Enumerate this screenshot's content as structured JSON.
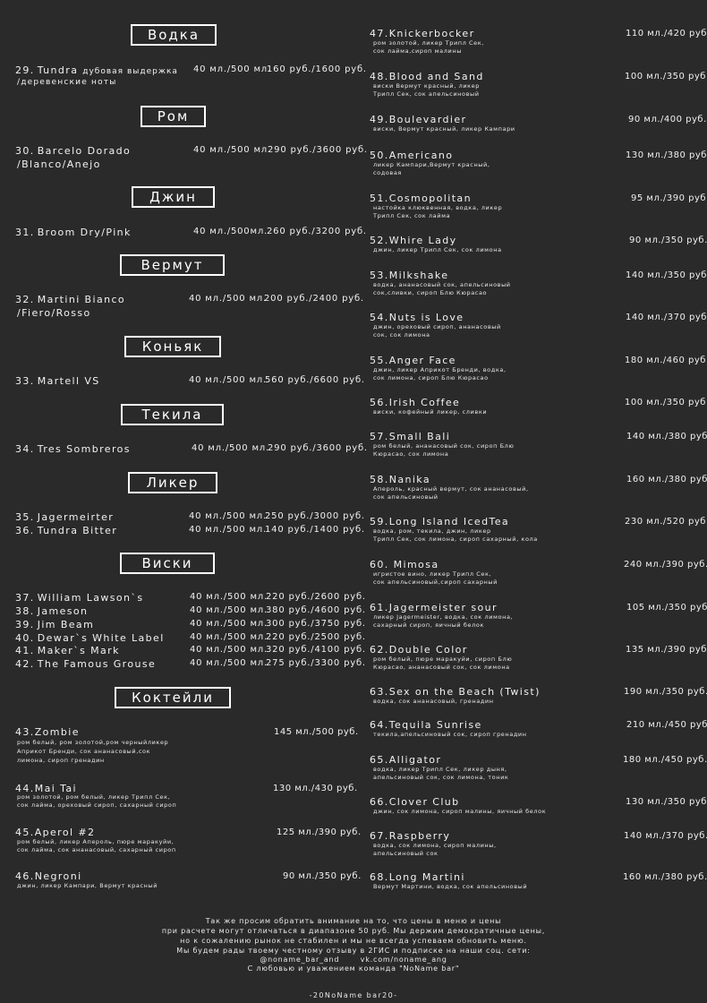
{
  "categories": {
    "vodka": "Водка",
    "rum": "Ром",
    "gin": "Джин",
    "vermouth": "Вермут",
    "cognac": "Коньяк",
    "tequila": "Текила",
    "liqueur": "Ликер",
    "whisky": "Виски",
    "cocktails": "Коктейли"
  },
  "drinks": [
    {
      "num": "29.",
      "name": "Tundra",
      "sub": "дубовая выдержка",
      "line2": "/деревенские ноты",
      "volume": "40 мл./500 мл.",
      "price": "160 руб./1600 руб."
    },
    {
      "num": "30.",
      "name": "Barcelo Dorado",
      "line2": "/Blanco/Anejo",
      "volume": "40 мл./500 мл.",
      "price": "290 руб./3600 руб."
    },
    {
      "num": "31.",
      "name": "Broom Dry/Pink",
      "volume": "40 мл./500мл.",
      "price": "260 руб./3200 руб."
    },
    {
      "num": "32.",
      "name": "Martini Bianco",
      "line2": "/Fiero/Rosso",
      "volume": "40 мл./500 мл.",
      "price": "200 руб./2400 руб."
    },
    {
      "num": "33.",
      "name": "Martell VS",
      "volume": "40 мл./500 мл.",
      "price": "560 руб./6600 руб."
    },
    {
      "num": "34.",
      "name": "Tres Sombreros",
      "volume": "40 мл./500 мл.",
      "price": "290 руб./3600 руб."
    },
    {
      "num": "35.",
      "name": "Jagermeirter",
      "volume": "40 мл./500 мл.",
      "price": "250 руб./3000 руб."
    },
    {
      "num": "36.",
      "name": "Tundra Bitter",
      "volume": "40 мл./500 мл.",
      "price": "140 руб./1400 руб."
    },
    {
      "num": "37.",
      "name": "William Lawson`s",
      "volume": "40 мл./500 мл.",
      "price": "220 руб./2600 руб."
    },
    {
      "num": "38.",
      "name": "Jameson",
      "volume": "40 мл./500 мл.",
      "price": "380 руб./4600 руб."
    },
    {
      "num": "39.",
      "name": "Jim Beam",
      "volume": "40 мл./500 мл.",
      "price": "300 руб./3750 руб."
    },
    {
      "num": "40.",
      "name": "Dewar`s White Label",
      "volume": "40 мл./500 мл.",
      "price": "220 руб./2500 руб."
    },
    {
      "num": "41.",
      "name": "Maker`s Mark",
      "volume": "40 мл./500 мл.",
      "price": "320 руб./4100 руб."
    },
    {
      "num": "42.",
      "name": "The Famous Grouse",
      "volume": "40 мл./500 мл.",
      "price": "275 руб./3300 руб."
    }
  ],
  "cocktails": [
    {
      "num": "43.",
      "name": "Zombie",
      "desc": [
        "ром белый, ром золотой,ром черныйликер",
        "Априкот Бренди, сок ананасовый,сок",
        "лимона, сироп гренадин"
      ],
      "price": "145 мл./500 руб."
    },
    {
      "num": "44.",
      "name": "Mai Tai",
      "desc": [
        "ром золотой, ром белый, ликер Трипл Сек,",
        "сок лайма, ореховый сироп, сахарный сироп"
      ],
      "price": "130 мл./430 руб."
    },
    {
      "num": "45.",
      "name": "Aperol #2",
      "desc": [
        "ром белый, ликер Апероль, пюре маракуйи,",
        "сок лайма, сок ананасовый, сахарный сироп"
      ],
      "price": "125 мл./390 руб."
    },
    {
      "num": "46.",
      "name": "Negroni",
      "desc": [
        "джин, ликер Кампари, Вермут красный"
      ],
      "price": "90 мл./350 руб."
    },
    {
      "num": "47.",
      "name": "Knickerbocker",
      "desc": [
        "ром золотой, ликер Трипл Сек,",
        "сок лайма,сироп малины"
      ],
      "price": "110 мл./420 руб."
    },
    {
      "num": "48.",
      "name": "Blood and Sand",
      "desc": [
        "виски Вермут красный, ликер",
        "Трипл Сек, сок апельсиновый"
      ],
      "price": "100 мл./350 руб."
    },
    {
      "num": "49.",
      "name": "Boulevardier",
      "desc": [
        "виски, Вермут красный, ликер Кампари"
      ],
      "price": "90 мл./400 руб."
    },
    {
      "num": "50.",
      "name": "Americano",
      "desc": [
        "ликер Кампари,Вермут красный,",
        "содовая"
      ],
      "price": "130 мл./380 руб."
    },
    {
      "num": "51.",
      "name": "Cosmopolitan",
      "desc": [
        "настойка клюквенная, водка, ликер",
        "Трипл Сек, сок лайма"
      ],
      "price": "95 мл./390 руб."
    },
    {
      "num": "52.",
      "name": "Whire Lady",
      "desc": [
        "джин, ликер Трипл Сек, сок лимона"
      ],
      "price": "90 мл./350 руб."
    },
    {
      "num": "53.",
      "name": "Milkshake",
      "desc": [
        "водка, ананасовый сок, апельсиновый",
        "сок,сливки, сироп Блю Кюрасао"
      ],
      "price": "140 мл./350 руб."
    },
    {
      "num": "54.",
      "name": "Nuts is Love",
      "desc": [
        "джин, ореховый сироп, ананасовый",
        "сок, сок лимона"
      ],
      "price": "140 мл./370 руб."
    },
    {
      "num": "55.",
      "name": "Anger Face",
      "desc": [
        "джин, ликер Априкот Бренди, водка,",
        "сок лимона, сироп Блю Кюрасао"
      ],
      "price": "180 мл./460 руб."
    },
    {
      "num": "56.",
      "name": "Irish Coffee",
      "desc": [
        "виски, кофейный ликер, сливки"
      ],
      "price": "100 мл./350 руб."
    },
    {
      "num": "57.",
      "name": "Small Bali",
      "desc": [
        "ром белый, ананасовый сок, сироп Блю",
        "Кюрасао, сок лимона"
      ],
      "price": "140 мл./380 руб."
    },
    {
      "num": "58.",
      "name": "Nanika",
      "desc": [
        "Апероль, красный вермут, сок ананасовый,",
        "сок апельсиновый"
      ],
      "price": "160 мл./380 руб."
    },
    {
      "num": "59.",
      "name": "Long Island IcedTea",
      "desc": [
        "водка, ром, текила, джин, ликер",
        "Трипл Сек, сок лимона, сироп сахарный, кола"
      ],
      "price": "230 мл./520 руб."
    },
    {
      "num": "60.",
      "name": " Mimosa",
      "desc": [
        "игристое вино, ликер Трипл Сек,",
        "сок апельсиновый,сироп сахарный"
      ],
      "price": "240 мл./390 руб."
    },
    {
      "num": "61.",
      "name": "Jagermeister sour",
      "desc": [
        "ликер Jagermeister, водка, сок лимона,",
        "сахарный сироп, яичный белок"
      ],
      "price": "105 мл./350 руб."
    },
    {
      "num": "62.",
      "name": "Double Color",
      "desc": [
        "ром белый, пюре маракуйи, сироп Блю",
        "Кюрасао, ананасовый сок, сок лимона"
      ],
      "price": "135 мл./390 руб."
    },
    {
      "num": "63.",
      "name": "Sex on the Beach (Twist)",
      "desc": [
        "водка, сок ананасовый, гренадин"
      ],
      "price": "190 мл./350 руб."
    },
    {
      "num": "64.",
      "name": "Tequila Sunrise",
      "desc": [
        "текила,апельсиновый сок, сироп гренадин"
      ],
      "price": "210 мл./450 руб."
    },
    {
      "num": "65.",
      "name": "Alligator",
      "desc": [
        "водка, ликер Трипл Сек, ликер дыня,",
        "апельсиновый сок, сок лимона, тоник"
      ],
      "price": "180 мл./450 руб."
    },
    {
      "num": "66.",
      "name": "Clover Club",
      "desc": [
        "джин, сок лимона, сироп малины, яичный белок"
      ],
      "price": "130 мл./350 руб."
    },
    {
      "num": "67.",
      "name": "Raspberry",
      "desc": [
        "водка, сок лимона, сироп малины,",
        "апельсиновый сок"
      ],
      "price": "140 мл./370 руб."
    },
    {
      "num": "68.",
      "name": "Long Martini",
      "desc": [
        "Вермут Мартини, водка, сок апельсиновый"
      ],
      "price": "160 мл./380 руб."
    }
  ],
  "footer": {
    "lines": [
      "Так же просим обратить внимание на то, что цены в меню и цены",
      "при расчете могут отличаться в диапазоне 50 руб. Мы держим демократичные цены,",
      "но к сожалению рынок не стабилен и мы не всегда успеваем обновить меню.",
      "Мы будем рады твоему честному отзыву в 2ГИС и подписке на наши соц. сети:",
      "@noname_bar_and       vk.com/noname_ang",
      "С любовью и уважением команда \"NoName bar\""
    ],
    "signature": "-20NoName bar20-"
  }
}
